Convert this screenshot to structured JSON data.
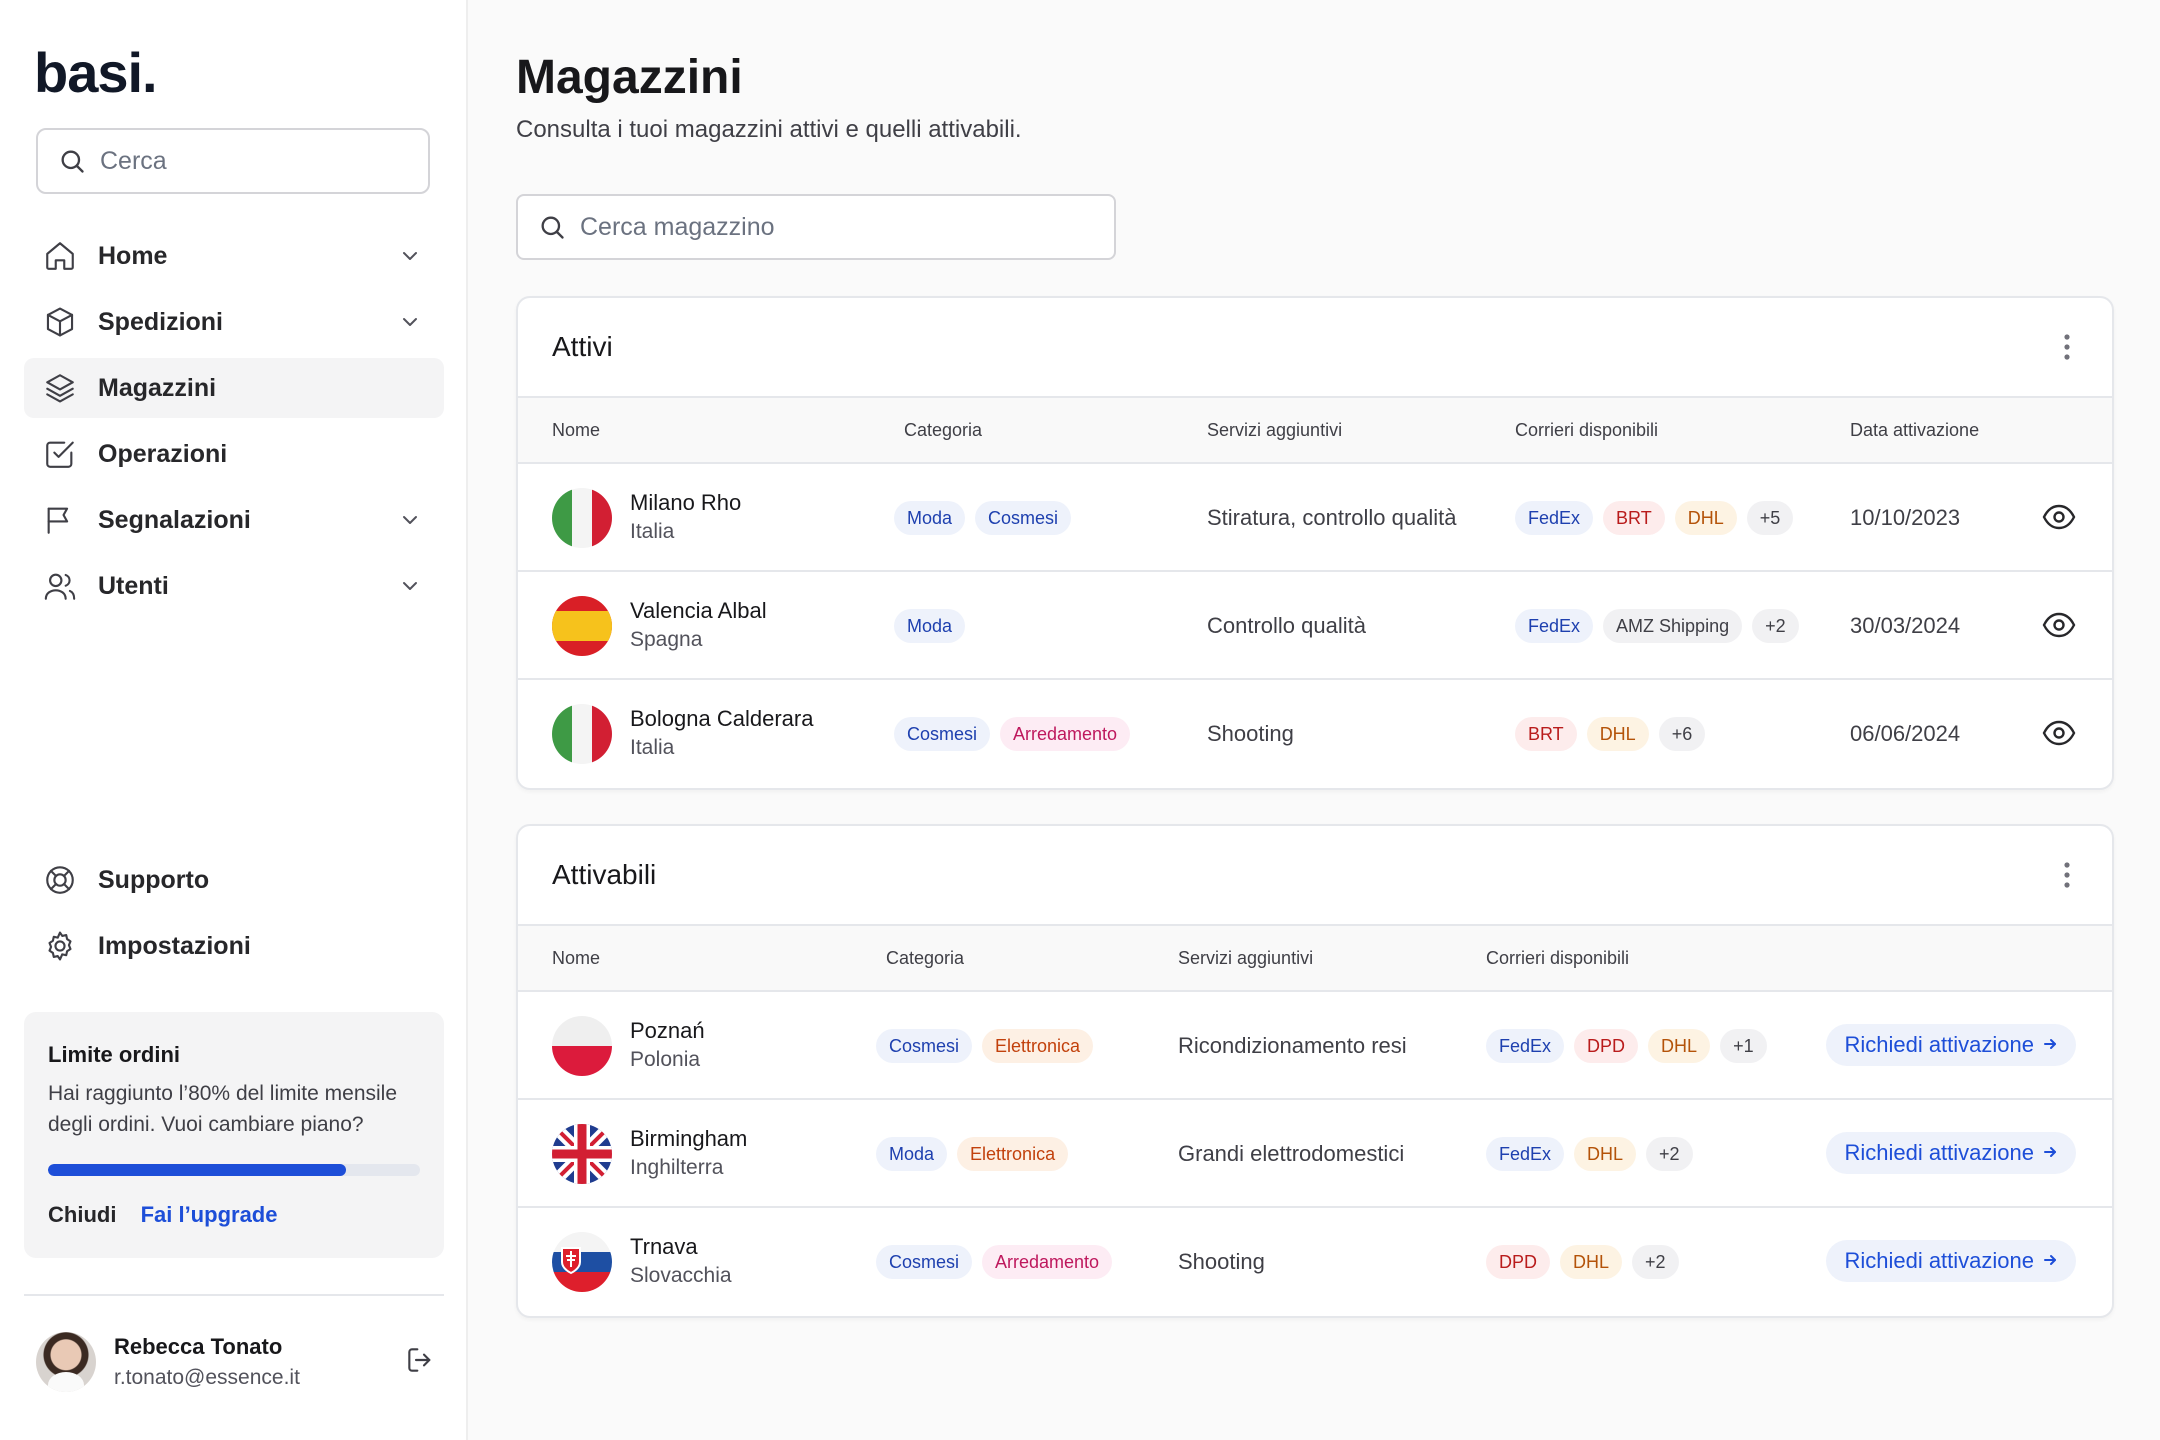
{
  "brand": {
    "logo": "basi."
  },
  "sidebar": {
    "search_placeholder": "Cerca",
    "items": [
      {
        "label": "Home",
        "icon": "home-icon",
        "has_chevron": true,
        "active": false
      },
      {
        "label": "Spedizioni",
        "icon": "box-icon",
        "has_chevron": true,
        "active": false
      },
      {
        "label": "Magazzini",
        "icon": "layers-icon",
        "has_chevron": false,
        "active": true
      },
      {
        "label": "Operazioni",
        "icon": "checkbox-icon",
        "has_chevron": false,
        "active": false
      },
      {
        "label": "Segnalazioni",
        "icon": "flag-icon",
        "has_chevron": true,
        "active": false
      },
      {
        "label": "Utenti",
        "icon": "users-icon",
        "has_chevron": true,
        "active": false
      }
    ],
    "bottom_items": [
      {
        "label": "Supporto",
        "icon": "lifebuoy-icon"
      },
      {
        "label": "Impostazioni",
        "icon": "gear-icon"
      }
    ],
    "limit_card": {
      "title": "Limite ordini",
      "text": "Hai raggiunto l’80% del limite mensile degli ordini. Vuoi cambiare piano?",
      "progress": 0.8,
      "close_label": "Chiudi",
      "upgrade_label": "Fai l’upgrade"
    },
    "user": {
      "name": "Rebecca Tonato",
      "email": "r.tonato@essence.it"
    }
  },
  "main": {
    "title": "Magazzini",
    "subtitle": "Consulta i tuoi magazzini attivi e quelli attivabili.",
    "search_placeholder": "Cerca magazzino",
    "active": {
      "title": "Attivi",
      "headers": {
        "name": "Nome",
        "category": "Categoria",
        "services": "Servizi aggiuntivi",
        "couriers": "Corrieri disponibili",
        "date": "Data attivazione"
      },
      "rows": [
        {
          "name": "Milano Rho",
          "country": "Italia",
          "flag": "it",
          "categories": [
            "Moda",
            "Cosmesi"
          ],
          "services": "Stiratura, controllo qualità",
          "couriers": [
            "FedEx",
            "BRT",
            "DHL",
            "+5"
          ],
          "date": "10/10/2023"
        },
        {
          "name": "Valencia Albal",
          "country": "Spagna",
          "flag": "es",
          "categories": [
            "Moda"
          ],
          "services": "Controllo qualità",
          "couriers": [
            "FedEx",
            "AMZ Shipping",
            "+2"
          ],
          "date": "30/03/2024"
        },
        {
          "name": "Bologna Calderara",
          "country": "Italia",
          "flag": "it",
          "categories": [
            "Cosmesi",
            "Arredamento"
          ],
          "services": "Shooting",
          "couriers": [
            "BRT",
            "DHL",
            "+6"
          ],
          "date": "06/06/2024"
        }
      ]
    },
    "available": {
      "title": "Attivabili",
      "headers": {
        "name": "Nome",
        "category": "Categoria",
        "services": "Servizi aggiuntivi",
        "couriers": "Corrieri disponibili"
      },
      "button_label": "Richiedi attivazione",
      "rows": [
        {
          "name": "Poznań",
          "country": "Polonia",
          "flag": "pl",
          "categories": [
            "Cosmesi",
            "Elettronica"
          ],
          "services": "Ricondizionamento resi",
          "couriers": [
            "FedEx",
            "DPD",
            "DHL",
            "+1"
          ]
        },
        {
          "name": "Birmingham",
          "country": "Inghilterra",
          "flag": "gb",
          "categories": [
            "Moda",
            "Elettronica"
          ],
          "services": "Grandi elettrodomestici",
          "couriers": [
            "FedEx",
            "DHL",
            "+2"
          ]
        },
        {
          "name": "Trnava",
          "country": "Slovacchia",
          "flag": "sk",
          "categories": [
            "Cosmesi",
            "Arredamento"
          ],
          "services": "Shooting",
          "couriers": [
            "DPD",
            "DHL",
            "+2"
          ]
        }
      ]
    }
  },
  "colors": {
    "accent": "#1d4ed8",
    "pill_blue_bg": "#eef2fb",
    "pill_blue_fg": "#1e40af",
    "pill_red_bg": "#fdecec",
    "pill_red_fg": "#b91c1c",
    "pill_orange_bg": "#fdf0e4",
    "pill_orange_fg": "#c2410c",
    "pill_pink_bg": "#fdecf4",
    "pill_pink_fg": "#be185d",
    "pill_grey_bg": "#f1f1f3",
    "pill_grey_fg": "#3f3f46",
    "pill_amber_bg": "#fdf3e3",
    "pill_amber_fg": "#b45309"
  }
}
